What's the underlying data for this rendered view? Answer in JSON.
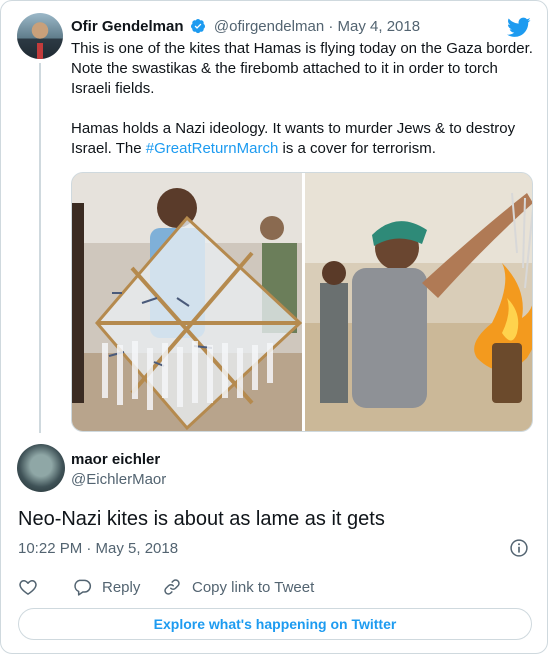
{
  "parent_tweet": {
    "author_name": "Ofir Gendelman",
    "handle": "@ofirgendelman",
    "separator": "·",
    "date": "May 4, 2018",
    "text_paragraph_1": "This is one of the kites that Hamas is flying today on the Gaza border. Note the swastikas & the firebomb attached to it in order to torch Israeli fields.",
    "text_paragraph_2_before": "Hamas holds a Nazi ideology. It wants to murder Jews & to destroy Israel. The ",
    "hashtag": "#GreatReturnMarch",
    "text_paragraph_2_after": " is a cover for terrorism."
  },
  "reply_tweet": {
    "author_name": "maor eichler",
    "handle": "@EichlerMaor",
    "text": "Neo-Nazi kites is about as lame as it gets",
    "timestamp": "10:22 PM · May 5, 2018"
  },
  "actions": {
    "reply_label": "Reply",
    "copy_link_label": "Copy link to Tweet"
  },
  "explore_label": "Explore what's happening on Twitter",
  "colors": {
    "accent": "#1d9bf0",
    "secondary_text": "#536471",
    "border": "#cfd9de"
  },
  "icons": [
    "verified-badge-icon",
    "twitter-bird-icon",
    "info-icon",
    "heart-icon",
    "reply-icon",
    "link-icon"
  ]
}
